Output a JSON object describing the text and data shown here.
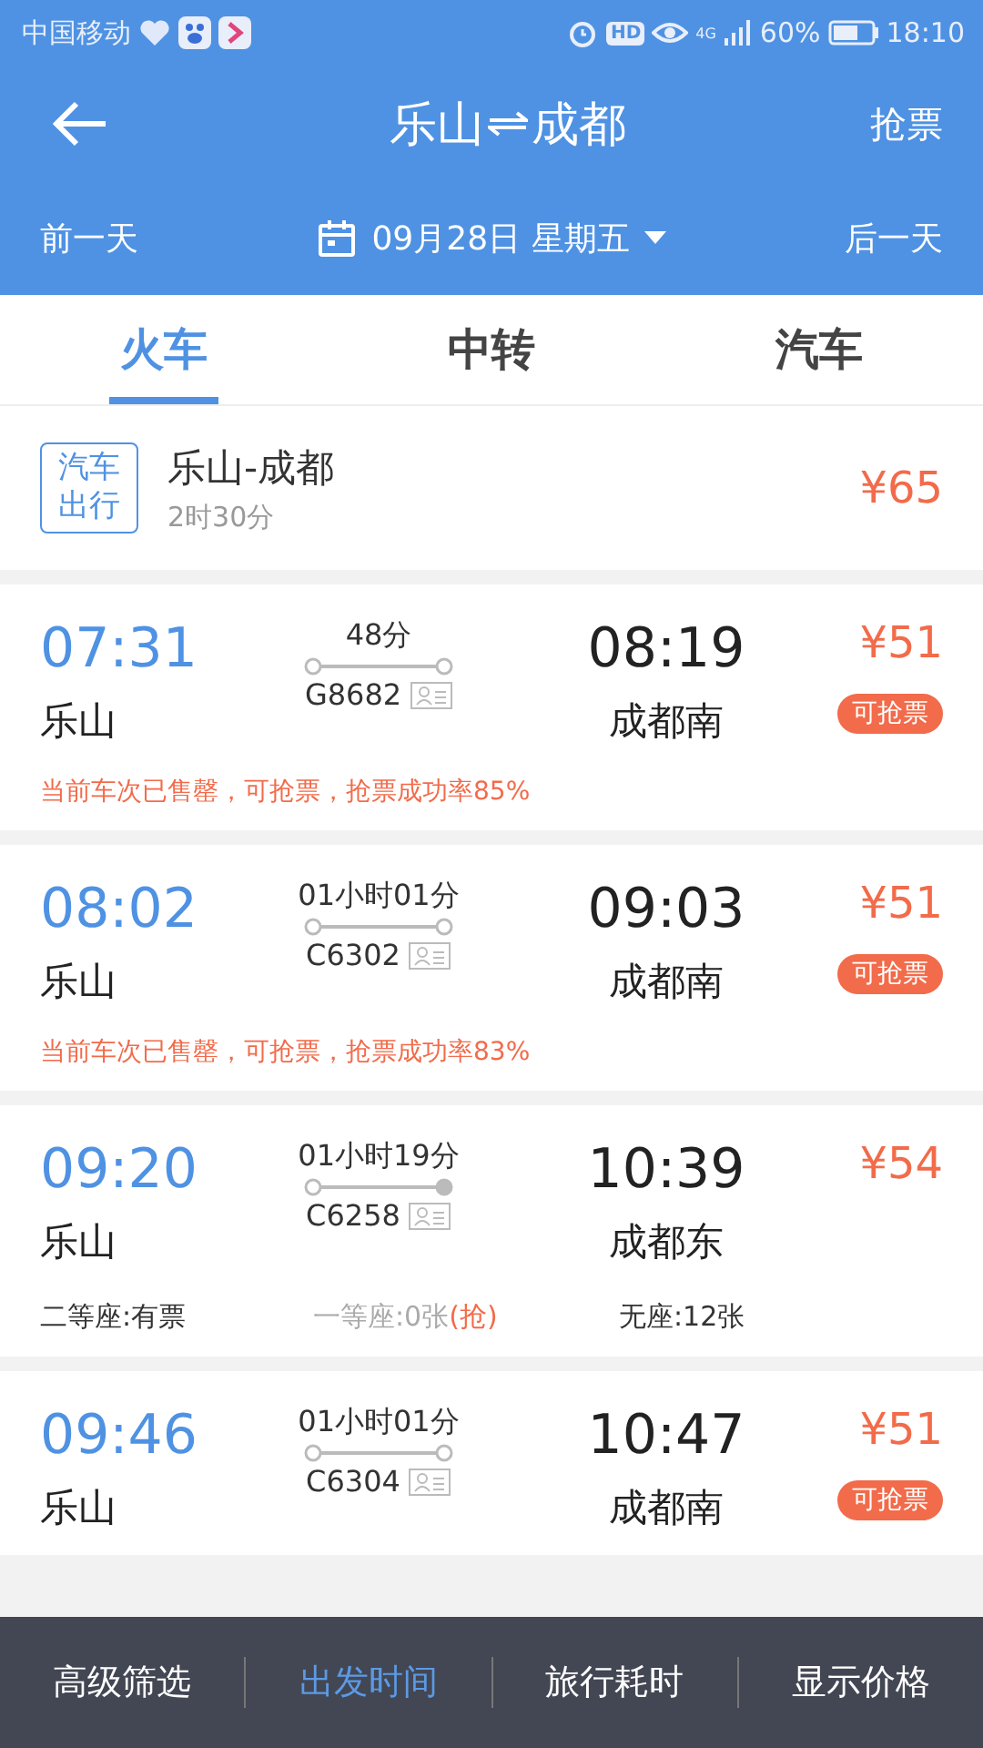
{
  "status_bar": {
    "carrier": "中国移动",
    "network": "4G",
    "battery": "60%",
    "time": "18:10",
    "hd": "HD"
  },
  "header": {
    "from": "乐山",
    "to": "成都",
    "action": "抢票"
  },
  "date_bar": {
    "prev": "前一天",
    "date": "09月28日 星期五",
    "next": "后一天"
  },
  "tabs": [
    {
      "label": "火车",
      "selected": true
    },
    {
      "label": "中转",
      "selected": false
    },
    {
      "label": "汽车",
      "selected": false
    }
  ],
  "bus_option": {
    "badge": "汽车出行",
    "route": "乐山-成都",
    "duration": "2时30分",
    "price": "¥65"
  },
  "trains": [
    {
      "depart": "07:31",
      "from": "乐山",
      "duration": "48分",
      "number": "G8682",
      "end_terminal": false,
      "arrive": "08:19",
      "to": "成都南",
      "price": "¥51",
      "badge": "可抢票",
      "note": "当前车次已售罄，可抢票，抢票成功率85%"
    },
    {
      "depart": "08:02",
      "from": "乐山",
      "duration": "01小时01分",
      "number": "C6302",
      "end_terminal": false,
      "arrive": "09:03",
      "to": "成都南",
      "price": "¥51",
      "badge": "可抢票",
      "note": "当前车次已售罄，可抢票，抢票成功率83%"
    },
    {
      "depart": "09:20",
      "from": "乐山",
      "duration": "01小时19分",
      "number": "C6258",
      "end_terminal": true,
      "arrive": "10:39",
      "to": "成都东",
      "price": "¥54",
      "seats": [
        {
          "text": "二等座:有票",
          "available": true
        },
        {
          "text": "一等座:0张",
          "available": false,
          "grab": "(抢)"
        },
        {
          "text": "无座:12张",
          "available": true
        }
      ]
    },
    {
      "depart": "09:46",
      "from": "乐山",
      "duration": "01小时01分",
      "number": "C6304",
      "end_terminal": false,
      "arrive": "10:47",
      "to": "成都南",
      "price": "¥51",
      "badge": "可抢票"
    }
  ],
  "bottom_bar": [
    {
      "label": "高级筛选",
      "selected": false
    },
    {
      "label": "出发时间",
      "selected": true
    },
    {
      "label": "旅行耗时",
      "selected": false
    },
    {
      "label": "显示价格",
      "selected": false
    }
  ]
}
